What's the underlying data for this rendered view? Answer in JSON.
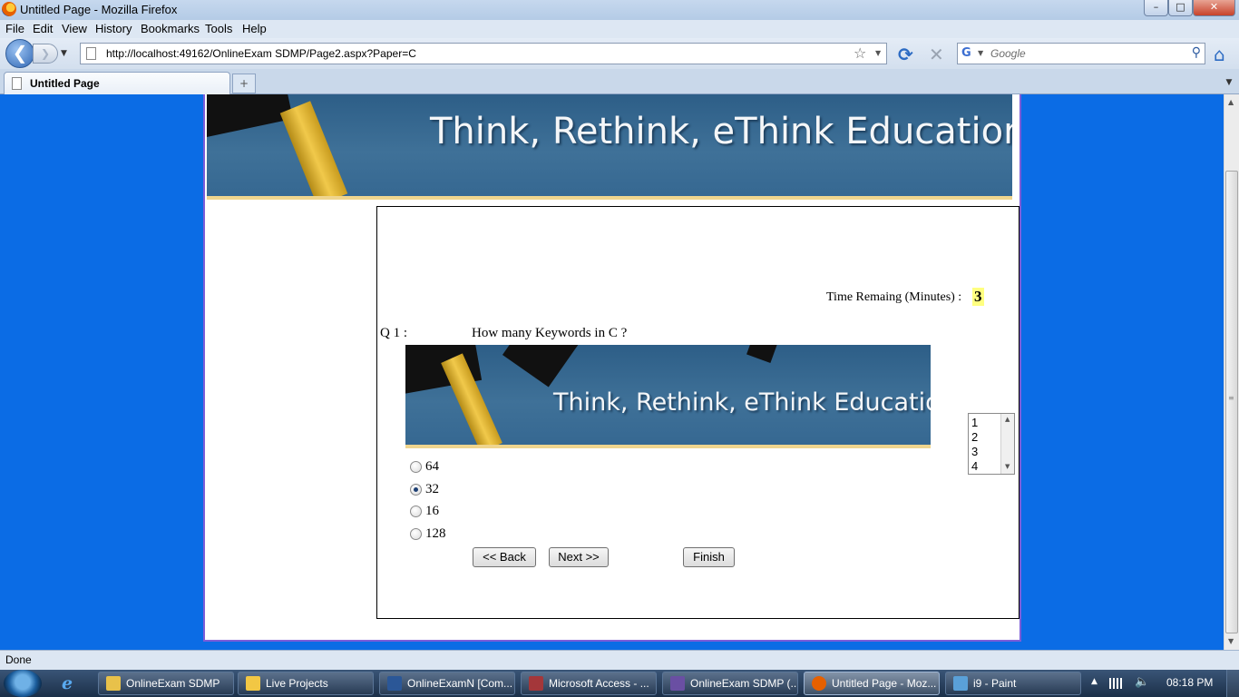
{
  "window": {
    "title": "Untitled Page - Mozilla Firefox",
    "minimize_glyph": "–",
    "maximize_glyph": "□",
    "close_glyph": "✕"
  },
  "menu": [
    "File",
    "Edit",
    "View",
    "History",
    "Bookmarks",
    "Tools",
    "Help"
  ],
  "navigation": {
    "back_glyph": "❮",
    "forward_glyph": "❯",
    "url": "http://localhost:49162/OnlineExam SDMP/Page2.aspx?Paper=C",
    "search_placeholder": "Google",
    "star_glyph": "☆",
    "reload_glyph": "⟳",
    "stop_glyph": "✕",
    "home_glyph": "⌂",
    "magnifier_glyph": "⚲"
  },
  "tabs": [
    {
      "label": "Untitled Page",
      "active": true
    }
  ],
  "new_tab_glyph": "+",
  "page": {
    "header_banner_text": "Think, Rethink, eThink Education",
    "time_label": "Time Remaing (Minutes) :",
    "time_value": "3",
    "question_number": "Q  1 :",
    "question_text": "How many Keywords in C ?",
    "question_image_text": "Think, Rethink, eThink Education",
    "options": [
      {
        "label": "64",
        "checked": false
      },
      {
        "label": "32",
        "checked": true
      },
      {
        "label": "16",
        "checked": false
      },
      {
        "label": "128",
        "checked": false
      }
    ],
    "buttons": {
      "back": "<< Back",
      "next": "Next >>",
      "finish": "Finish"
    },
    "question_list": [
      "1",
      "2",
      "3",
      "4"
    ]
  },
  "status_bar": {
    "text": "Done"
  },
  "taskbar": {
    "items": [
      {
        "label": "OnlineExam SDMP",
        "icon_color": "#e8c14a",
        "active": false
      },
      {
        "label": "Live Projects",
        "icon_color": "#f2c744",
        "active": false
      },
      {
        "label": "OnlineExamN [Com...",
        "icon_color": "#2b5797",
        "active": false
      },
      {
        "label": "Microsoft Access - ...",
        "icon_color": "#a4373a",
        "active": false
      },
      {
        "label": "OnlineExam SDMP (...",
        "icon_color": "#6a4fa3",
        "active": false
      },
      {
        "label": "Untitled Page - Moz...",
        "icon_color": "#e66000",
        "active": true
      },
      {
        "label": "i9 - Paint",
        "icon_color": "#5aa0d8",
        "active": false
      }
    ],
    "clock": "08:18 PM"
  },
  "colors": {
    "page_background": "#0b6ce5",
    "time_highlight": "#ffff80",
    "banner_blue": "#356791",
    "banner_stripe": "#efd58e"
  }
}
